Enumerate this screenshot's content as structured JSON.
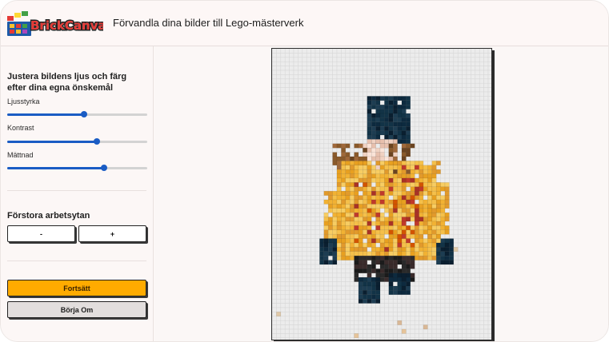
{
  "header": {
    "logo_text": "BrickCanvas",
    "tagline": "Förvandla dina bilder till Lego-mästerverk"
  },
  "sidebar": {
    "adjust_heading": "Justera bildens ljus och färg efter dina egna önskemål",
    "sliders": [
      {
        "label": "Ljusstyrka",
        "value": 0.55
      },
      {
        "label": "Kontrast",
        "value": 0.64
      },
      {
        "label": "Mättnad",
        "value": 0.69
      }
    ],
    "zoom_heading": "Förstora arbetsytan",
    "zoom_out_label": "-",
    "zoom_in_label": "+",
    "continue_label": "Fortsätt",
    "restart_label": "Börja Om"
  },
  "colors": {
    "accent": "#1a5cc4",
    "primary_button": "#ffab00",
    "secondary_button": "#e2dedd"
  }
}
